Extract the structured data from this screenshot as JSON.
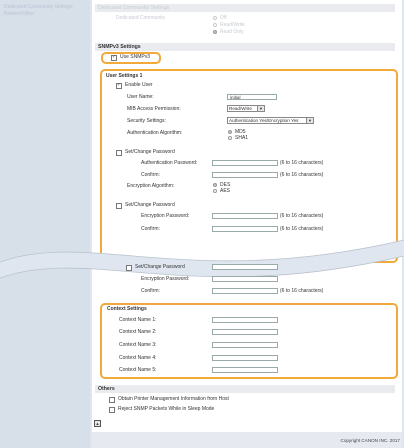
{
  "sidebar": {
    "items": [
      "Dedicated Community Settings",
      "Kitchen/Other"
    ]
  },
  "dedicated": {
    "header": "Dedicated Community Settings",
    "label": "Dedicated Community",
    "options": [
      "Off",
      "Read/Write",
      "Read Only"
    ]
  },
  "snmpv3": {
    "header": "SNMPv3 Settings",
    "use_label": "Use SNMPv3"
  },
  "user1": {
    "header": "User Settings 1",
    "enable_label": "Enable User",
    "username_label": "User Name:",
    "username_value": "initial",
    "mib_label": "MIB Access Permission:",
    "mib_value": "Read/Write",
    "security_label": "Security Settings:",
    "security_value": "Authentication Yes/Encryption Yes",
    "auth_alg_label": "Authentication Algorithm:",
    "auth_alg_options": [
      "MD5",
      "SHA1"
    ],
    "set_change_pw": "Set/Change Password",
    "auth_pw_label": "Authentication Password:",
    "confirm_label": "Confirm:",
    "pw_hint": "(6 to 16 characters)",
    "enc_alg_label": "Encryption Algorithm:",
    "enc_alg_options": [
      "DES",
      "AES"
    ],
    "enc_pw_label": "Encryption Password:"
  },
  "lower": {
    "set_change_pw": "Set/Change Password",
    "enc_pw_label": "Encryption Password:",
    "confirm_label": "Confirm:",
    "pw_hint": "(6 to 16 characters)"
  },
  "context": {
    "header": "Context Settings",
    "labels": [
      "Context Name 1:",
      "Context Name 2:",
      "Context Name 3:",
      "Context Name 4:",
      "Context Name 5:"
    ]
  },
  "others": {
    "header": "Others",
    "items": [
      "Obtain Printer Management Information from Host",
      "Reject SNMP Packets While in Sleep Mode"
    ]
  },
  "footer": {
    "copyright": "Copyright CANON INC. 2017"
  },
  "colors": {
    "highlight": "#f0a93a",
    "background": "#dfe6ef",
    "section_header": "#e9ebef"
  }
}
